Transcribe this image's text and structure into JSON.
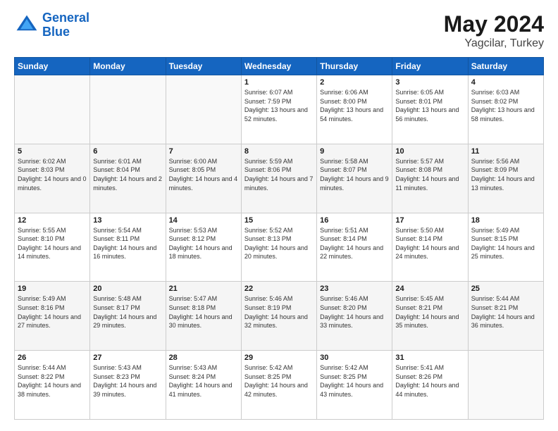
{
  "header": {
    "logo_line1": "General",
    "logo_line2": "Blue",
    "month_year": "May 2024",
    "location": "Yagcilar, Turkey"
  },
  "days_of_week": [
    "Sunday",
    "Monday",
    "Tuesday",
    "Wednesday",
    "Thursday",
    "Friday",
    "Saturday"
  ],
  "weeks": [
    [
      {
        "num": "",
        "sunrise": "",
        "sunset": "",
        "daylight": ""
      },
      {
        "num": "",
        "sunrise": "",
        "sunset": "",
        "daylight": ""
      },
      {
        "num": "",
        "sunrise": "",
        "sunset": "",
        "daylight": ""
      },
      {
        "num": "1",
        "sunrise": "Sunrise: 6:07 AM",
        "sunset": "Sunset: 7:59 PM",
        "daylight": "Daylight: 13 hours and 52 minutes."
      },
      {
        "num": "2",
        "sunrise": "Sunrise: 6:06 AM",
        "sunset": "Sunset: 8:00 PM",
        "daylight": "Daylight: 13 hours and 54 minutes."
      },
      {
        "num": "3",
        "sunrise": "Sunrise: 6:05 AM",
        "sunset": "Sunset: 8:01 PM",
        "daylight": "Daylight: 13 hours and 56 minutes."
      },
      {
        "num": "4",
        "sunrise": "Sunrise: 6:03 AM",
        "sunset": "Sunset: 8:02 PM",
        "daylight": "Daylight: 13 hours and 58 minutes."
      }
    ],
    [
      {
        "num": "5",
        "sunrise": "Sunrise: 6:02 AM",
        "sunset": "Sunset: 8:03 PM",
        "daylight": "Daylight: 14 hours and 0 minutes."
      },
      {
        "num": "6",
        "sunrise": "Sunrise: 6:01 AM",
        "sunset": "Sunset: 8:04 PM",
        "daylight": "Daylight: 14 hours and 2 minutes."
      },
      {
        "num": "7",
        "sunrise": "Sunrise: 6:00 AM",
        "sunset": "Sunset: 8:05 PM",
        "daylight": "Daylight: 14 hours and 4 minutes."
      },
      {
        "num": "8",
        "sunrise": "Sunrise: 5:59 AM",
        "sunset": "Sunset: 8:06 PM",
        "daylight": "Daylight: 14 hours and 7 minutes."
      },
      {
        "num": "9",
        "sunrise": "Sunrise: 5:58 AM",
        "sunset": "Sunset: 8:07 PM",
        "daylight": "Daylight: 14 hours and 9 minutes."
      },
      {
        "num": "10",
        "sunrise": "Sunrise: 5:57 AM",
        "sunset": "Sunset: 8:08 PM",
        "daylight": "Daylight: 14 hours and 11 minutes."
      },
      {
        "num": "11",
        "sunrise": "Sunrise: 5:56 AM",
        "sunset": "Sunset: 8:09 PM",
        "daylight": "Daylight: 14 hours and 13 minutes."
      }
    ],
    [
      {
        "num": "12",
        "sunrise": "Sunrise: 5:55 AM",
        "sunset": "Sunset: 8:10 PM",
        "daylight": "Daylight: 14 hours and 14 minutes."
      },
      {
        "num": "13",
        "sunrise": "Sunrise: 5:54 AM",
        "sunset": "Sunset: 8:11 PM",
        "daylight": "Daylight: 14 hours and 16 minutes."
      },
      {
        "num": "14",
        "sunrise": "Sunrise: 5:53 AM",
        "sunset": "Sunset: 8:12 PM",
        "daylight": "Daylight: 14 hours and 18 minutes."
      },
      {
        "num": "15",
        "sunrise": "Sunrise: 5:52 AM",
        "sunset": "Sunset: 8:13 PM",
        "daylight": "Daylight: 14 hours and 20 minutes."
      },
      {
        "num": "16",
        "sunrise": "Sunrise: 5:51 AM",
        "sunset": "Sunset: 8:14 PM",
        "daylight": "Daylight: 14 hours and 22 minutes."
      },
      {
        "num": "17",
        "sunrise": "Sunrise: 5:50 AM",
        "sunset": "Sunset: 8:14 PM",
        "daylight": "Daylight: 14 hours and 24 minutes."
      },
      {
        "num": "18",
        "sunrise": "Sunrise: 5:49 AM",
        "sunset": "Sunset: 8:15 PM",
        "daylight": "Daylight: 14 hours and 25 minutes."
      }
    ],
    [
      {
        "num": "19",
        "sunrise": "Sunrise: 5:49 AM",
        "sunset": "Sunset: 8:16 PM",
        "daylight": "Daylight: 14 hours and 27 minutes."
      },
      {
        "num": "20",
        "sunrise": "Sunrise: 5:48 AM",
        "sunset": "Sunset: 8:17 PM",
        "daylight": "Daylight: 14 hours and 29 minutes."
      },
      {
        "num": "21",
        "sunrise": "Sunrise: 5:47 AM",
        "sunset": "Sunset: 8:18 PM",
        "daylight": "Daylight: 14 hours and 30 minutes."
      },
      {
        "num": "22",
        "sunrise": "Sunrise: 5:46 AM",
        "sunset": "Sunset: 8:19 PM",
        "daylight": "Daylight: 14 hours and 32 minutes."
      },
      {
        "num": "23",
        "sunrise": "Sunrise: 5:46 AM",
        "sunset": "Sunset: 8:20 PM",
        "daylight": "Daylight: 14 hours and 33 minutes."
      },
      {
        "num": "24",
        "sunrise": "Sunrise: 5:45 AM",
        "sunset": "Sunset: 8:21 PM",
        "daylight": "Daylight: 14 hours and 35 minutes."
      },
      {
        "num": "25",
        "sunrise": "Sunrise: 5:44 AM",
        "sunset": "Sunset: 8:21 PM",
        "daylight": "Daylight: 14 hours and 36 minutes."
      }
    ],
    [
      {
        "num": "26",
        "sunrise": "Sunrise: 5:44 AM",
        "sunset": "Sunset: 8:22 PM",
        "daylight": "Daylight: 14 hours and 38 minutes."
      },
      {
        "num": "27",
        "sunrise": "Sunrise: 5:43 AM",
        "sunset": "Sunset: 8:23 PM",
        "daylight": "Daylight: 14 hours and 39 minutes."
      },
      {
        "num": "28",
        "sunrise": "Sunrise: 5:43 AM",
        "sunset": "Sunset: 8:24 PM",
        "daylight": "Daylight: 14 hours and 41 minutes."
      },
      {
        "num": "29",
        "sunrise": "Sunrise: 5:42 AM",
        "sunset": "Sunset: 8:25 PM",
        "daylight": "Daylight: 14 hours and 42 minutes."
      },
      {
        "num": "30",
        "sunrise": "Sunrise: 5:42 AM",
        "sunset": "Sunset: 8:25 PM",
        "daylight": "Daylight: 14 hours and 43 minutes."
      },
      {
        "num": "31",
        "sunrise": "Sunrise: 5:41 AM",
        "sunset": "Sunset: 8:26 PM",
        "daylight": "Daylight: 14 hours and 44 minutes."
      },
      {
        "num": "",
        "sunrise": "",
        "sunset": "",
        "daylight": ""
      }
    ]
  ]
}
